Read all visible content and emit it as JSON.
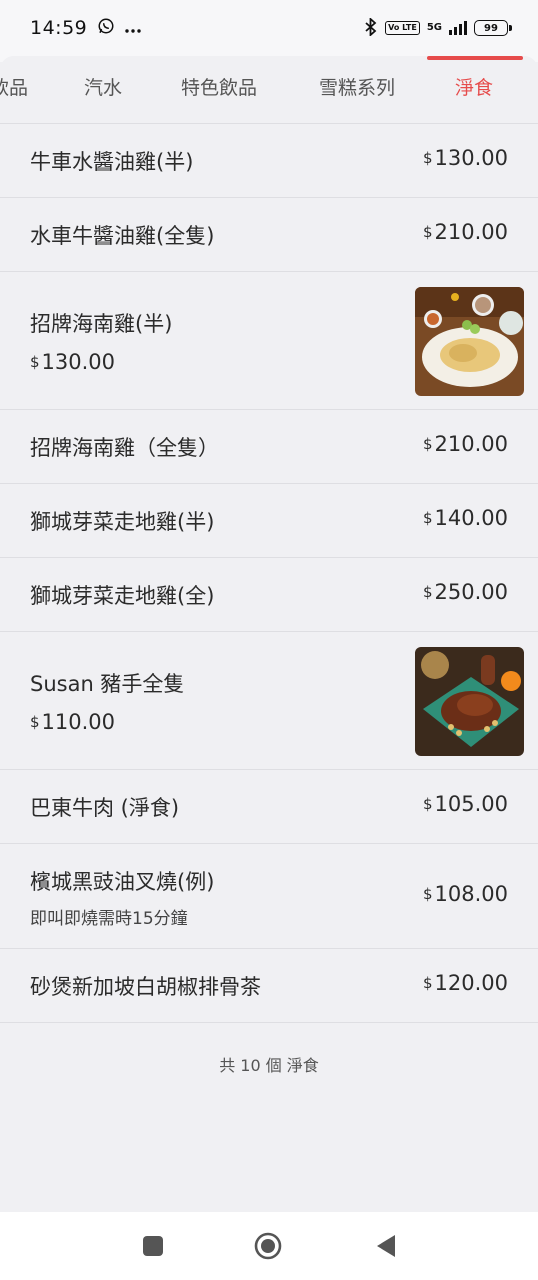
{
  "status": {
    "time": "14:59",
    "left_icons": [
      "whatsapp-icon",
      "more-icon"
    ],
    "volte": "Vo LTE",
    "network": "5G",
    "battery": "99"
  },
  "tabs": [
    {
      "label": "飲品"
    },
    {
      "label": "汽水"
    },
    {
      "label": "特色飲品"
    },
    {
      "label": "雪糕系列"
    },
    {
      "label": "淨食"
    }
  ],
  "active_tab": "淨食",
  "currency_symbol": "$",
  "items": [
    {
      "name": "牛車水醬油雞(半)",
      "price": "130.00"
    },
    {
      "name": "水車牛醬油雞(全隻)",
      "price": "210.00"
    },
    {
      "name": "招牌海南雞(半)",
      "price": "130.00",
      "image": "hainan-chicken-photo"
    },
    {
      "name": "招牌海南雞（全隻）",
      "price": "210.00"
    },
    {
      "name": "獅城芽菜走地雞(半)",
      "price": "140.00"
    },
    {
      "name": "獅城芽菜走地雞(全)",
      "price": "250.00"
    },
    {
      "name": "Susan 豬手全隻",
      "price": "110.00",
      "image": "pork-knuckle-photo"
    },
    {
      "name": "巴東牛肉 (淨食)",
      "price": "105.00"
    },
    {
      "name": "檳城黑豉油叉燒(例)",
      "price": "108.00",
      "note": "即叫即燒需時15分鐘"
    },
    {
      "name": "砂煲新加坡白胡椒排骨茶",
      "price": "120.00"
    }
  ],
  "footer": {
    "count_text": "共 10 個 淨食"
  },
  "colors": {
    "accent": "#e64b4b",
    "background": "#f0f0f3",
    "divider": "#dedee2"
  }
}
